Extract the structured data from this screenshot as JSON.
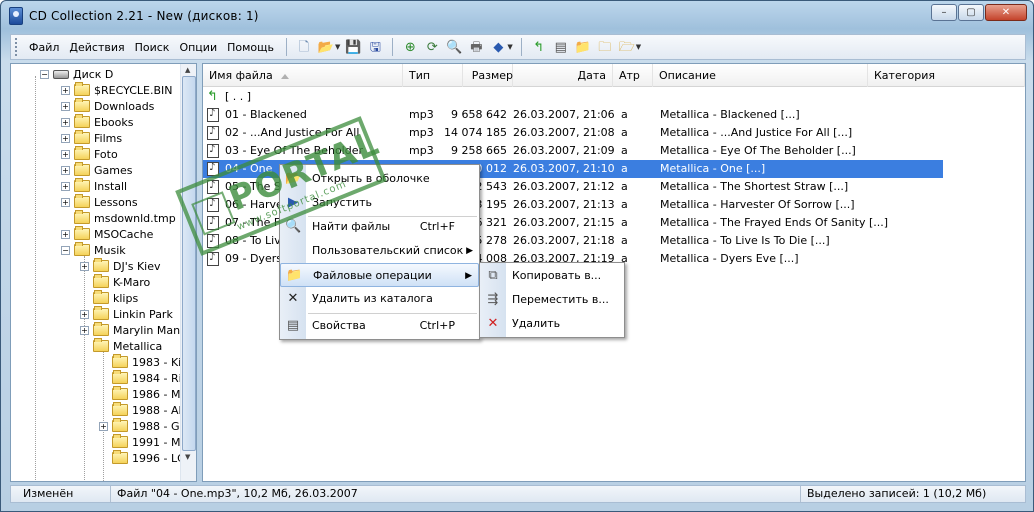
{
  "window": {
    "title": "CD Collection 2.21  -  New (дисков: 1)",
    "min": "–",
    "max": "▢",
    "close": "✕"
  },
  "menu": [
    "Файл",
    "Действия",
    "Поиск",
    "Опции",
    "Помощь"
  ],
  "toolbar_icons": [
    "new-doc-icon",
    "open-folder-icon",
    "save-icon",
    "save-as-icon",
    "scan-disk-icon",
    "refresh-icon",
    "search-icon",
    "print-icon",
    "report-icon",
    "go-up-icon",
    "properties-icon",
    "folder-open-icon",
    "folder-icon",
    "folder-add-icon"
  ],
  "tree": {
    "root": "Диск D",
    "items": [
      {
        "label": "$RECYCLE.BIN",
        "expand": true,
        "type": "folder"
      },
      {
        "label": "Downloads",
        "expand": true,
        "type": "folder"
      },
      {
        "label": "Ebooks",
        "expand": true,
        "type": "folder"
      },
      {
        "label": "Films",
        "expand": true,
        "type": "folder"
      },
      {
        "label": "Foto",
        "expand": true,
        "type": "folder"
      },
      {
        "label": "Games",
        "expand": true,
        "type": "folder"
      },
      {
        "label": "Install",
        "expand": true,
        "type": "folder"
      },
      {
        "label": "Lessons",
        "expand": true,
        "type": "folder"
      },
      {
        "label": "msdownld.tmp",
        "expand": false,
        "type": "folder"
      },
      {
        "label": "MSOCache",
        "expand": true,
        "type": "folder"
      },
      {
        "label": "Musik",
        "expand": true,
        "type": "folder"
      }
    ],
    "musik_items": [
      {
        "label": "DJ's Kiev",
        "expand": true
      },
      {
        "label": "K-Maro",
        "expand": false
      },
      {
        "label": "klips",
        "expand": false
      },
      {
        "label": "Linkin Park",
        "expand": true
      },
      {
        "label": "Marylin Mans",
        "expand": true
      },
      {
        "label": "Metallica",
        "expand": false
      }
    ],
    "metallica_items": [
      {
        "label": "1983 - Ki",
        "expand": false
      },
      {
        "label": "1984 - Ri",
        "expand": false
      },
      {
        "label": "1986 - Ma",
        "expand": false
      },
      {
        "label": "1988 - Al",
        "expand": false
      },
      {
        "label": "1988 - Ga",
        "expand": true
      },
      {
        "label": "1991 - Me",
        "expand": false
      },
      {
        "label": "1996 - LC",
        "expand": false
      }
    ]
  },
  "columns": [
    "Имя файла",
    "Тип",
    "Размер",
    "Дата",
    "Атр",
    "Описание",
    "Категория"
  ],
  "up_row": "[ . . ]",
  "files": [
    {
      "name": "01 - Blackened",
      "type": "mp3",
      "size": "9 658 642",
      "date": "26.03.2007, 21:06",
      "attr": "a",
      "desc": "Metallica - Blackened [...]"
    },
    {
      "name": "02 - ...And Justice For All",
      "type": "mp3",
      "size": "14 074 185",
      "date": "26.03.2007, 21:08",
      "attr": "a",
      "desc": "Metallica - ...And Justice For All [...]"
    },
    {
      "name": "03 - Eye Of The Beholder",
      "type": "mp3",
      "size": "9 258 665",
      "date": "26.03.2007, 21:09",
      "attr": "a",
      "desc": "Metallica - Eye Of The Beholder [...]"
    },
    {
      "name": "04 - One",
      "type": "",
      "size": "0 012",
      "date": "26.03.2007, 21:10",
      "attr": "a",
      "desc": "Metallica - One [...]",
      "selected": true
    },
    {
      "name": "05 - The Sh",
      "type": "",
      "size": "2 543",
      "date": "26.03.2007, 21:12",
      "attr": "a",
      "desc": "Metallica - The Shortest Straw [...]"
    },
    {
      "name": "06 - Harves",
      "type": "",
      "size": "3 195",
      "date": "26.03.2007, 21:13",
      "attr": "a",
      "desc": "Metallica - Harvester Of Sorrow [...]"
    },
    {
      "name": "07 - The Fr",
      "type": "",
      "size": "6 321",
      "date": "26.03.2007, 21:15",
      "attr": "a",
      "desc": "Metallica - The Frayed Ends Of Sanity [...]"
    },
    {
      "name": "08 - To Liv",
      "type": "",
      "size": "5 278",
      "date": "26.03.2007, 21:18",
      "attr": "a",
      "desc": "Metallica - To Live Is To Die [...]"
    },
    {
      "name": "09 - Dyers",
      "type": "",
      "size": "4 008",
      "date": "26.03.2007, 21:19",
      "attr": "a",
      "desc": "Metallica - Dyers Eve [...]"
    }
  ],
  "context_menu": [
    {
      "label": "Открыть в оболочке",
      "shortcut": "",
      "icon": "folder-open-icon",
      "arrow": false
    },
    {
      "label": "Запустить",
      "shortcut": "",
      "icon": "run-icon",
      "arrow": false
    },
    {
      "label": "Найти файлы",
      "shortcut": "Ctrl+F",
      "icon": "search-icon",
      "arrow": false
    },
    {
      "label": "Пользовательский список",
      "shortcut": "",
      "icon": "",
      "arrow": true
    },
    {
      "label": "Файловые операции",
      "shortcut": "",
      "icon": "folder-icon",
      "arrow": true,
      "highlight": true
    },
    {
      "label": "Удалить из каталога",
      "shortcut": "",
      "icon": "remove-icon",
      "arrow": false
    },
    {
      "label": "Свойства",
      "shortcut": "Ctrl+P",
      "icon": "properties-icon",
      "arrow": false
    }
  ],
  "submenu": [
    {
      "label": "Копировать в...",
      "icon": "copy-icon"
    },
    {
      "label": "Переместить в...",
      "icon": "move-icon"
    },
    {
      "label": "Удалить",
      "icon": "delete-icon"
    }
  ],
  "status": {
    "state": "Изменён",
    "file": "Файл \"04 - One.mp3\",  10,2 Мб,  26.03.2007",
    "selected": "Выделено записей: 1 (10,2 Мб)"
  },
  "watermark": {
    "text": "PORTAL",
    "url": "www.softportal.com"
  }
}
